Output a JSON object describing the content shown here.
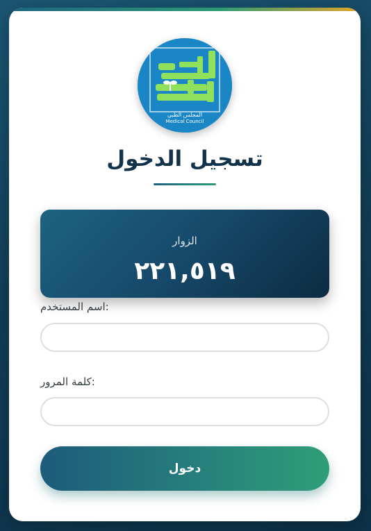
{
  "logo": {
    "icon": "medical-council-logo",
    "arabic_name": "المجلس الطبي",
    "english_name": "Medical Council"
  },
  "page": {
    "title": "تسجيل الدخول"
  },
  "visitors": {
    "label": "الزوار",
    "count": "٢٢١,٥١٩"
  },
  "form": {
    "username_label": "اسم المستخدم:",
    "username_value": "",
    "password_label": "كلمة المرور:",
    "password_value": "",
    "submit_label": "دخول"
  },
  "colors": {
    "background": "#123f58",
    "card": "#ffffff",
    "title": "#12334a",
    "accent_start": "#1d5b7b",
    "accent_end": "#2f9e77",
    "top_bar_end": "#e3a52a"
  }
}
